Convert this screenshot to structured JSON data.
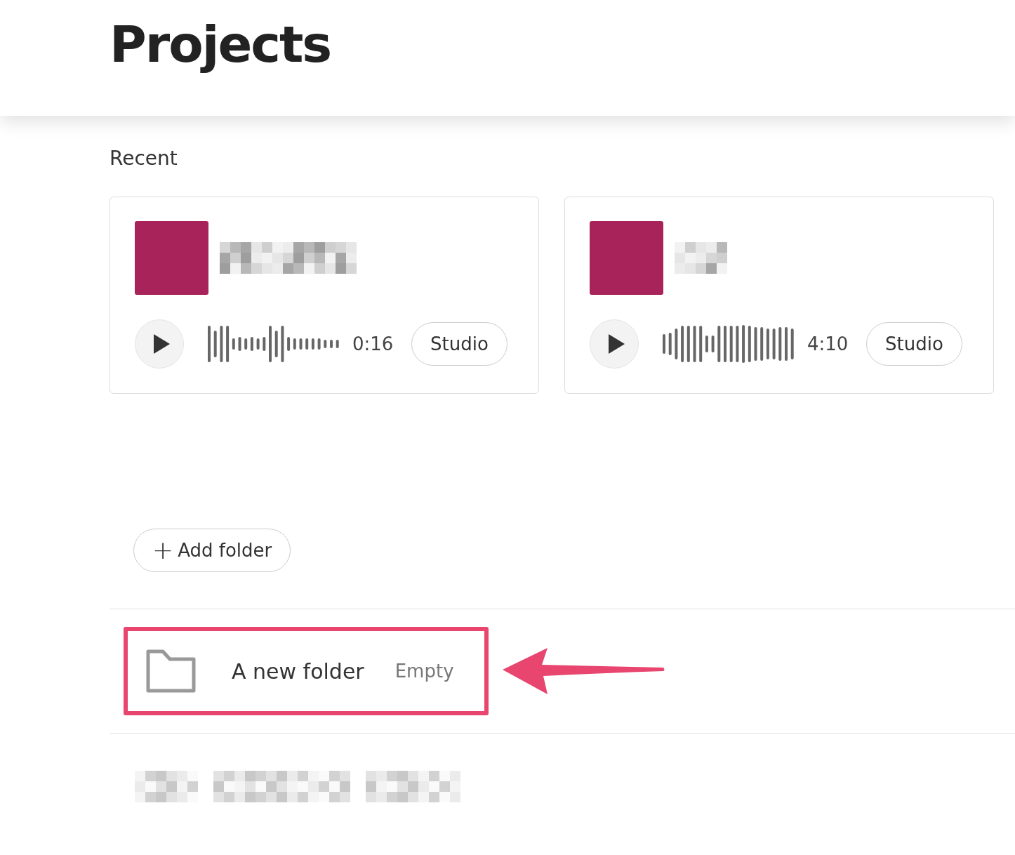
{
  "header": {
    "title": "Projects"
  },
  "recent": {
    "heading": "Recent",
    "projects": [
      {
        "duration": "0:16",
        "action": "Studio",
        "color": "#a8235a"
      },
      {
        "duration": "4:10",
        "action": "Studio",
        "color": "#a8235a"
      }
    ]
  },
  "add_folder": {
    "label": "Add folder",
    "icon": "+"
  },
  "folders": [
    {
      "name": "A new folder",
      "status": "Empty",
      "highlighted": true
    }
  ]
}
